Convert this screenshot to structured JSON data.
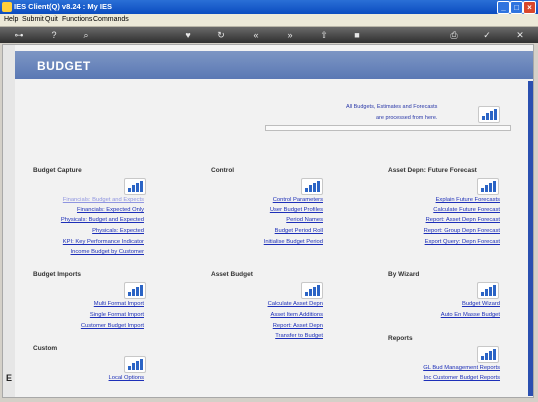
{
  "window": {
    "title": "IES Client(Q) v8.24 : My IES"
  },
  "menu": [
    "Help",
    "Submit",
    "Quit",
    "Functions",
    "Commands"
  ],
  "toolbar_icons": [
    "key-icon",
    "help-icon",
    "search-icon",
    "heart-icon",
    "refresh-icon",
    "rewind-icon",
    "fast-forward-icon",
    "upload-icon",
    "stop-icon",
    "print-icon",
    "check-icon",
    "close-icon"
  ],
  "page": {
    "title": "BUDGET"
  },
  "info": {
    "line1": "All Budgets, Estimates and Forecasts",
    "line2": "are processed from here."
  },
  "sections": {
    "budget_capture": {
      "title": "Budget Capture",
      "links": [
        "Financials: Budget and Expects",
        "Financials: Expected Only",
        "Physicals: Budget and Expected",
        "Physicals: Expected",
        "KPI: Key Performance Indicator",
        "Income Budget by Customer"
      ]
    },
    "control": {
      "title": "Control",
      "links": [
        "Control Parameters",
        "User Budget Profiles",
        "Period Names",
        "Budget Period Roll",
        "Initialise Budget Period"
      ]
    },
    "asset_depn": {
      "title": "Asset Depn: Future Forecast",
      "links": [
        "Explain Future Forecasts",
        "Calculate Future Forecast",
        "Report: Asset Depn Forecast",
        "Report: Group Depn Forecast",
        "Export Query: Depn Forecast"
      ]
    },
    "budget_imports": {
      "title": "Budget Imports",
      "links": [
        "Multi Format Import",
        "Single Format Import",
        "Customer Budget Import"
      ]
    },
    "asset_budget": {
      "title": "Asset Budget",
      "links": [
        "Calculate Asset Depn",
        "Asset Item Additions",
        "Report: Asset Depn",
        "Transfer to Budget"
      ]
    },
    "by_wizard": {
      "title": "By Wizard",
      "links": [
        "Budget Wizard",
        "Auto En Masse Budget"
      ]
    },
    "custom": {
      "title": "Custom",
      "links": [
        "Local Options"
      ]
    },
    "reports": {
      "title": "Reports",
      "links": [
        "GL Bud Management Reports",
        "Inc Customer Budget Reports"
      ]
    }
  },
  "colors": {
    "link": "#1d2fb8",
    "header": "#6a84bb",
    "titlebar": "#0b4cc0"
  }
}
